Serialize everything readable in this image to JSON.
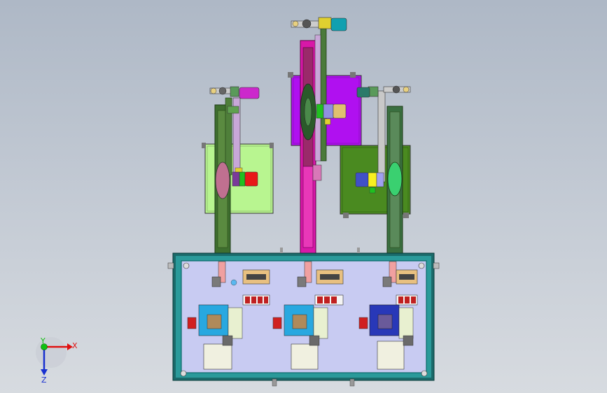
{
  "triad": {
    "x_label": "X",
    "y_label": "Y",
    "z_label": "Z",
    "x_color": "#e01010",
    "y_color": "#10c010",
    "z_color": "#1830d0"
  },
  "palette": {
    "background_top": "#aeb8c6",
    "background_bottom": "#d7dbe0",
    "base_plate": "#c8cbf2",
    "frame": "#0a7a7a",
    "left_panel": "#b8f590",
    "center_panel": "#b010f0",
    "right_panel": "#4a8a20",
    "belt_left": "#3f6f2f",
    "belt_center": "#d818a8",
    "belt_right": "#3a6f40"
  }
}
